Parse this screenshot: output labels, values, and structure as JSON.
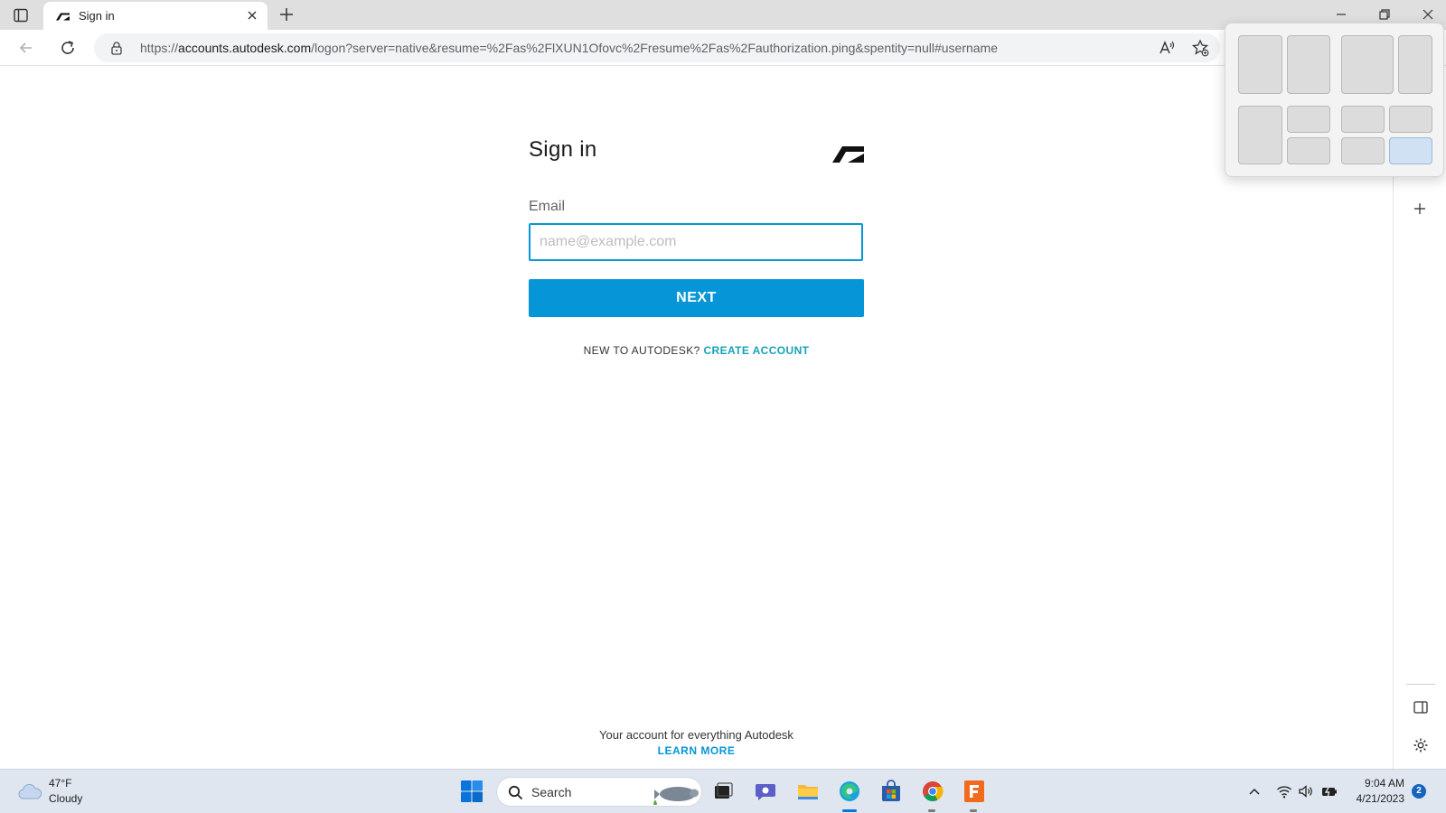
{
  "browser": {
    "tab_title": "Sign in",
    "url_prefix": "https://",
    "url_host": "accounts.autodesk.com",
    "url_rest": "/logon?server=native&resume=%2Fas%2FlXUN1Ofovc%2Fresume%2Fas%2Fauthorization.ping&spentity=null#username"
  },
  "signin": {
    "title": "Sign in",
    "email_label": "Email",
    "email_placeholder": "name@example.com",
    "email_value": "",
    "next_label": "NEXT",
    "new_prefix": "NEW TO AUTODESK?",
    "create_account_label": "CREATE ACCOUNT",
    "footer_text": "Your account for everything Autodesk",
    "learn_more_label": "LEARN MORE"
  },
  "taskbar": {
    "weather_temp": "47°F",
    "weather_condition": "Cloudy",
    "search_label": "Search",
    "time": "9:04 AM",
    "date": "4/21/2023",
    "notification_count": "2"
  },
  "colors": {
    "accent": "#0696d7",
    "link_teal": "#17a2b8",
    "taskbar_bg": "#dfe6ef"
  },
  "icons": {
    "tab_actions": "tab-actions-icon",
    "favicon": "autodesk-logo-icon",
    "snap_layouts": "snap-layouts-flyout",
    "read_aloud": "read-aloud-icon",
    "favorites": "add-favorite-icon"
  }
}
